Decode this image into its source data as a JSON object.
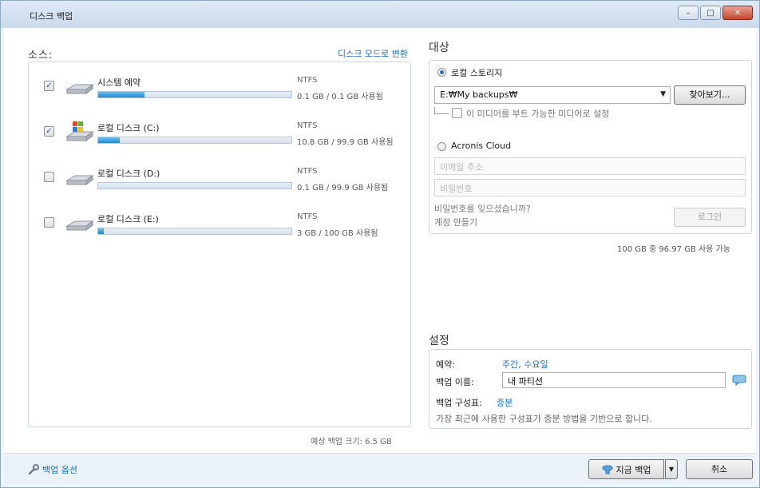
{
  "window": {
    "title": "디스크 백업"
  },
  "source": {
    "label": "소스:",
    "disk_mode_link": "디스크 모드로 변환",
    "disks": [
      {
        "name": "시스템 예약",
        "fs": "NTFS",
        "usage": "0.1 GB / 0.1 GB 사용됨",
        "checked": true,
        "fill_fraction": 0.24,
        "icon": "hard-drive-icon"
      },
      {
        "name": "로컬 디스크 (C:)",
        "fs": "NTFS",
        "usage": "10.8 GB / 99.9 GB 사용됨",
        "checked": true,
        "fill_fraction": 0.11,
        "icon": "windows-drive-icon"
      },
      {
        "name": "로컬 디스크 (D:)",
        "fs": "NTFS",
        "usage": "0.1 GB / 99.9 GB 사용됨",
        "checked": false,
        "fill_fraction": 0.0,
        "icon": "hard-drive-icon"
      },
      {
        "name": "로컬 디스크 (E:)",
        "fs": "NTFS",
        "usage": "3 GB / 100 GB 사용됨",
        "checked": false,
        "fill_fraction": 0.03,
        "icon": "hard-drive-icon"
      }
    ],
    "estimated_size": "예상 백업 크기: 6.5 GB"
  },
  "target": {
    "label": "대상",
    "local_storage": {
      "label": "로컬 스토리지",
      "selected": true
    },
    "path_value": "E:₩My backups₩",
    "browse_label": "찾아보기...",
    "bootable_label": "이 미디어를 부트 가능한 미디어로 설정",
    "cloud": {
      "label": "Acronis Cloud",
      "selected": false
    },
    "email_placeholder": "이메일 주소",
    "password_placeholder": "비밀번호",
    "forgot_password": "비밀번호를 잊으셨습니까?",
    "create_account": "계정 만들기",
    "login_label": "로그인",
    "available": "100 GB 중 96.97 GB 사용 가능"
  },
  "settings": {
    "label": "설정",
    "schedule_key": "예약:",
    "schedule_value": "주간, 수요일",
    "backup_name_key": "백업 이름:",
    "backup_name_value": "내 파티션",
    "scheme_key": "백업 구성표:",
    "scheme_value": "증분",
    "scheme_desc": "가장 최근에 사용한 구성표가 증분 방법을 기반으로 합니다."
  },
  "footer": {
    "options_label": "백업 옵션",
    "backup_now_label": "지금 백업",
    "cancel_label": "취소"
  },
  "colors": {
    "accent_link": "#1a6fc7",
    "progress_fill": "#1d87d2",
    "close_button": "#c7452c"
  }
}
